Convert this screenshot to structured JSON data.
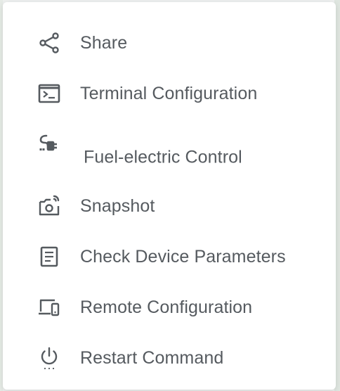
{
  "menu": {
    "items": [
      {
        "label": "Share",
        "icon": "share-icon"
      },
      {
        "label": "Terminal Configuration",
        "icon": "terminal-icon"
      },
      {
        "label": "Fuel-electric Control",
        "icon": "plug-icon"
      },
      {
        "label": "Snapshot",
        "icon": "camera-icon"
      },
      {
        "label": "Check Device Parameters",
        "icon": "document-icon"
      },
      {
        "label": "Remote Configuration",
        "icon": "devices-icon"
      },
      {
        "label": "Restart Command",
        "icon": "power-icon"
      }
    ]
  },
  "colors": {
    "icon": "#555a5f",
    "text": "#555a5f",
    "background": "#ffffff"
  }
}
